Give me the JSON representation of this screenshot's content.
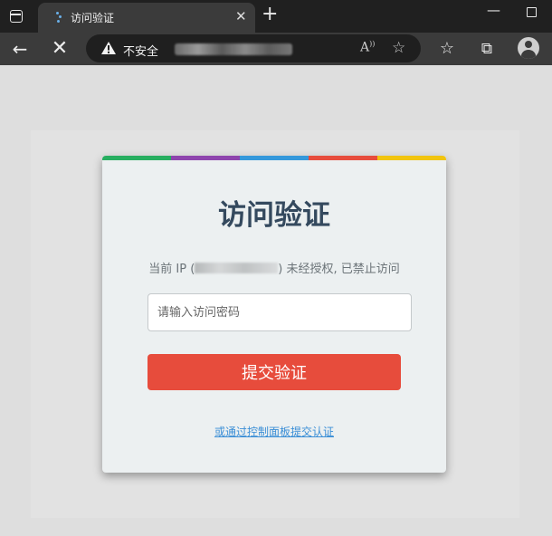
{
  "tab": {
    "title": "访问验证"
  },
  "address_bar": {
    "security_label": "不安全"
  },
  "card": {
    "stripe_colors": [
      "#27ae60",
      "#8e44ad",
      "#3498db",
      "#e74c3c",
      "#f1c40f"
    ],
    "title": "访问验证",
    "ip_prefix": "当前 IP (",
    "ip_suffix": ") 未经授权, 已禁止访问",
    "password_placeholder": "请输入访问密码",
    "submit_label": "提交验证",
    "panel_link": "或通过控制面板提交认证"
  },
  "icons": {
    "tab_actions": "tab-actions-icon",
    "close": "close-icon",
    "new_tab": "plus-icon",
    "minimize": "minimize-icon",
    "maximize": "maximize-icon",
    "back": "back-arrow-icon",
    "stop": "stop-icon",
    "warning": "warning-icon",
    "read_aloud": "read-aloud-icon",
    "add_favorite": "add-favorite-icon",
    "favorites": "favorites-icon",
    "collections": "collections-icon",
    "profile": "profile-icon"
  }
}
